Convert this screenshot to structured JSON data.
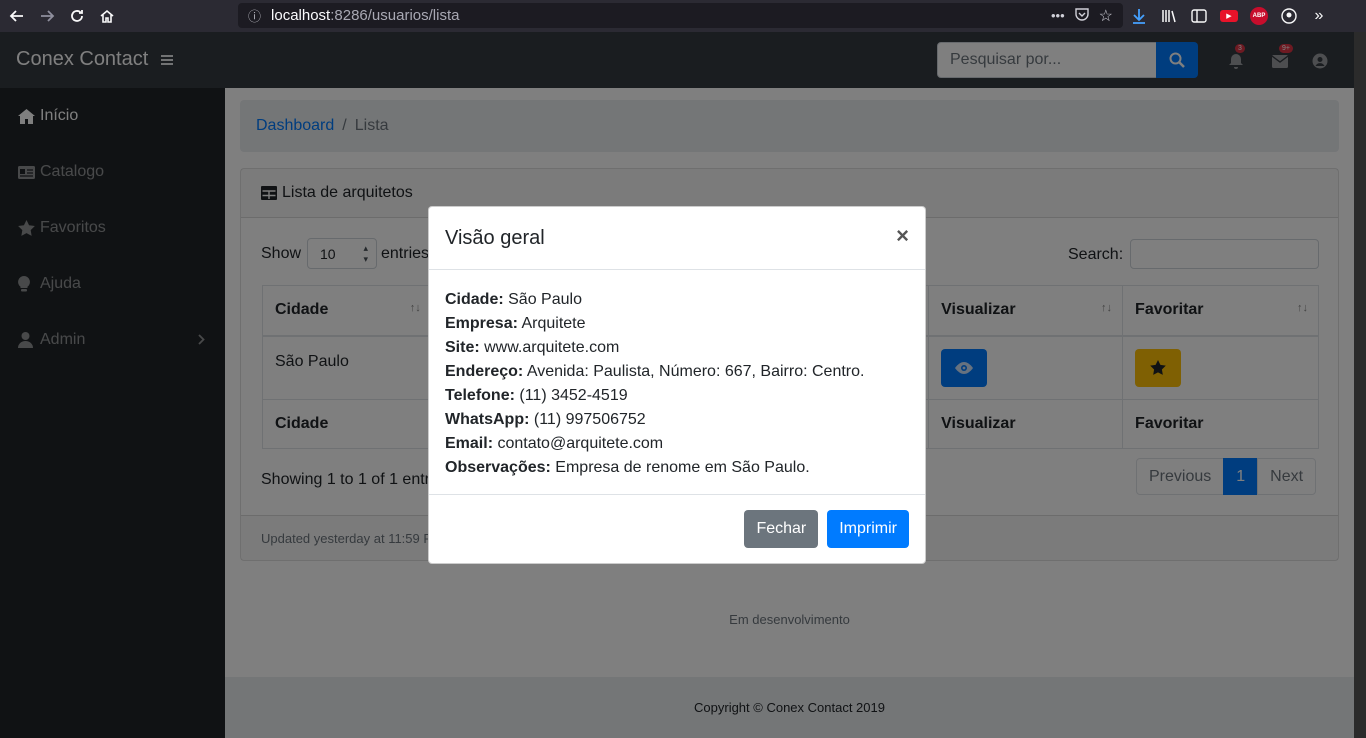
{
  "browser": {
    "url_host": "localhost",
    "url_path": ":8286/usuarios/lista"
  },
  "navbar": {
    "brand": "Conex Contact",
    "search_placeholder": "Pesquisar por...",
    "notifications_count": "3",
    "messages_count": "9+"
  },
  "sidebar": {
    "items": [
      {
        "label": "Início",
        "icon": "home-icon"
      },
      {
        "label": "Catalogo",
        "icon": "id-card-icon"
      },
      {
        "label": "Favoritos",
        "icon": "star-icon"
      },
      {
        "label": "Ajuda",
        "icon": "lightbulb-icon"
      },
      {
        "label": "Admin",
        "icon": "user-icon"
      }
    ]
  },
  "breadcrumb": {
    "link": "Dashboard",
    "separator": "/",
    "active": "Lista"
  },
  "card": {
    "title": "Lista de arquitetos",
    "show_label": "Show",
    "page_length": "10",
    "entries_label": "entries",
    "search_label": "Search:",
    "columns": [
      "Cidade",
      "Visualizar",
      "Favoritar"
    ],
    "rows": [
      {
        "cidade": "São Paulo"
      }
    ],
    "info": "Showing 1 to 1 of 1 entries",
    "pagination": {
      "previous": "Previous",
      "current": "1",
      "next": "Next"
    },
    "footer": "Updated yesterday at 11:59 PM"
  },
  "dev_text": "Em desenvolvimento",
  "footer": "Copyright © Conex Contact 2019",
  "modal": {
    "title": "Visão geral",
    "close": "×",
    "fields": [
      {
        "label": "Cidade:",
        "value": "São Paulo"
      },
      {
        "label": "Empresa:",
        "value": "Arquitete"
      },
      {
        "label": "Site:",
        "value": "www.arquitete.com"
      },
      {
        "label": "Endereço:",
        "value": "Avenida: Paulista, Número: 667, Bairro: Centro."
      },
      {
        "label": "Telefone:",
        "value": "(11) 3452-4519"
      },
      {
        "label": "WhatsApp:",
        "value": "(11) 997506752"
      },
      {
        "label": "Email:",
        "value": "contato@arquitete.com"
      },
      {
        "label": "Observações:",
        "value": "Empresa de renome em São Paulo."
      }
    ],
    "close_button": "Fechar",
    "print_button": "Imprimir"
  },
  "colors": {
    "primary": "#007bff",
    "secondary": "#6c757d",
    "warning": "#ffc107",
    "sidebar": "#212529",
    "navbar": "#343a40"
  }
}
